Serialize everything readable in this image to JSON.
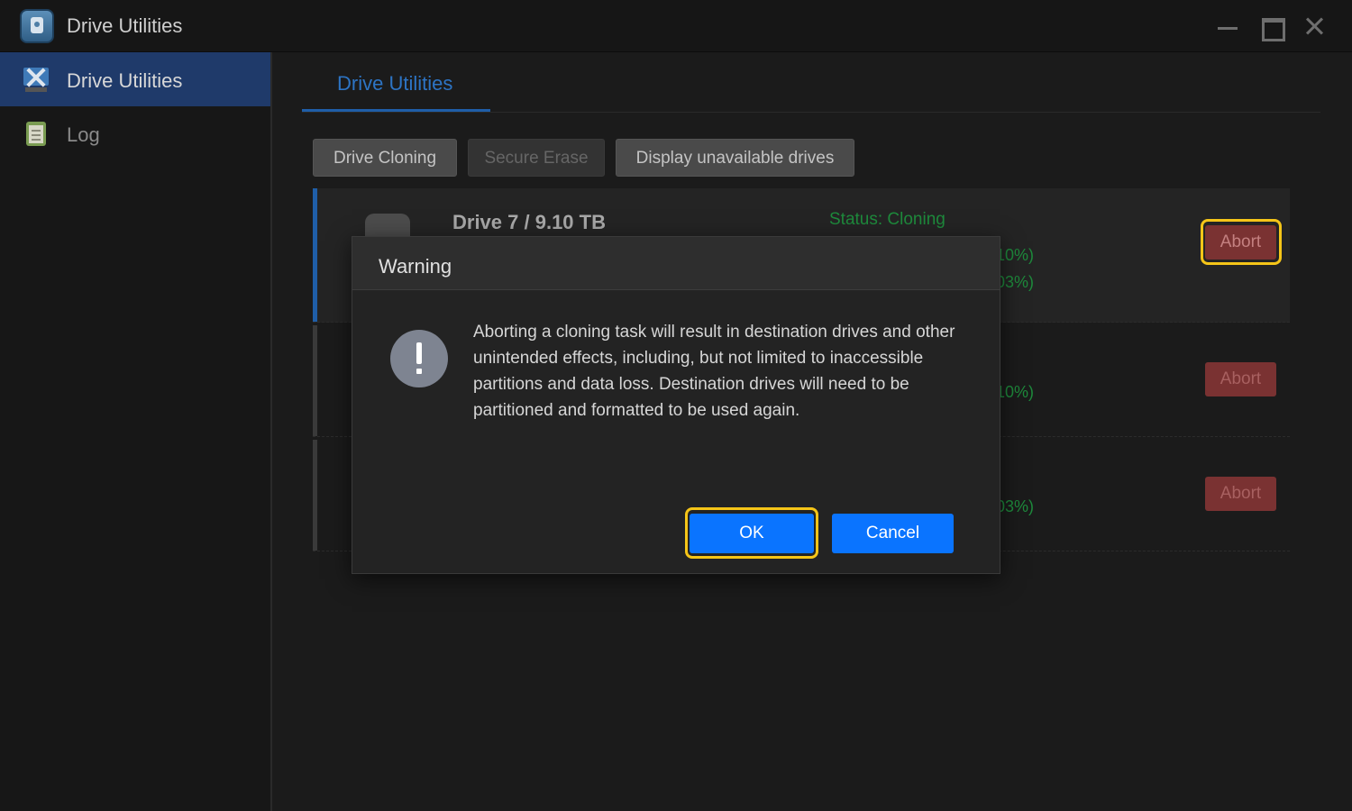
{
  "window": {
    "title": "Drive Utilities"
  },
  "sidebar": {
    "items": [
      {
        "label": "Drive Utilities",
        "icon": "tools-icon",
        "active": true
      },
      {
        "label": "Log",
        "icon": "log-icon",
        "active": false
      }
    ]
  },
  "main": {
    "tab": "Drive Utilities",
    "toolbar": {
      "drive_cloning": "Drive Cloning",
      "secure_erase": "Secure Erase",
      "display_unavailable": "Display unavailable drives"
    },
    "rows": [
      {
        "name": "Drive 7 / 9.10 TB",
        "status": "Status: Cloning",
        "pct1": "10%)",
        "pct2": "03%)",
        "abort": "Abort"
      },
      {
        "pct1": "10%)",
        "abort": "Abort"
      },
      {
        "pct1": "03%)",
        "abort": "Abort"
      }
    ]
  },
  "dialog": {
    "title": "Warning",
    "message": "Aborting a cloning task will result in destination drives and other unintended effects, including, but not limited to inaccessible partitions and data loss. Destination drives will need to be partitioned and formatted to be used again.",
    "ok": "OK",
    "cancel": "Cancel"
  },
  "colors": {
    "accent": "#0a74ff",
    "status_green": "#1e8a3c",
    "abort_red": "#7a3232",
    "highlight": "#f5c518"
  }
}
